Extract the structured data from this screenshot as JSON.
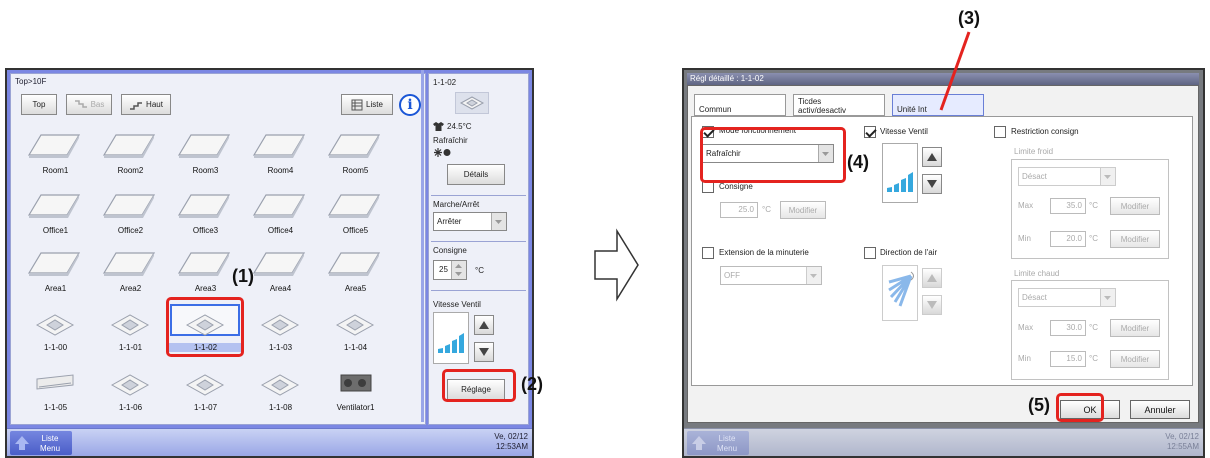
{
  "left": {
    "breadcrumb": "Top>10F",
    "toolbar": {
      "top": "Top",
      "bas": "Bas",
      "haut": "Haut",
      "liste": "Liste",
      "info": "i"
    },
    "rows": [
      {
        "type": "ceiling",
        "labels": [
          "Room1",
          "Room2",
          "Room3",
          "Room4",
          "Room5"
        ]
      },
      {
        "type": "ceiling",
        "labels": [
          "Office1",
          "Office2",
          "Office3",
          "Office4",
          "Office5"
        ]
      },
      {
        "type": "ceiling",
        "labels": [
          "Area1",
          "Area2",
          "Area3",
          "Area4",
          "Area5"
        ]
      },
      {
        "type": "cassette",
        "labels": [
          "1-1-00",
          "1-1-01",
          "1-1-02",
          "1-1-03",
          "1-1-04"
        ]
      },
      {
        "type": "mixed",
        "labels": [
          "1-1-05",
          "1-1-06",
          "1-1-07",
          "1-1-08",
          "Ventilator1"
        ]
      }
    ],
    "selected_unit": "1-1-02",
    "panel": {
      "unit": "1-1-02",
      "temperature": "24.5°C",
      "mode": "Rafraîchir",
      "details_btn": "Détails",
      "onoff_label": "Marche/Arrêt",
      "onoff_value": "Arrêter",
      "setpoint_label": "Consigne",
      "setpoint_value": "25",
      "setpoint_unit": "°C",
      "fan_label": "Vitesse Ventil",
      "reglage_btn": "Réglage"
    },
    "taskbar": {
      "liste": "Liste",
      "menu": "Menu",
      "date": "Ve, 02/12",
      "time": "12:53AM"
    }
  },
  "callouts": {
    "c1": "(1)",
    "c2": "(2)",
    "c3": "(3)",
    "c4": "(4)",
    "c5": "(5)"
  },
  "right": {
    "title": "Régl détaillé : 1-1-02",
    "tabs": {
      "commun": "Commun",
      "ticdes1": "Ticdes",
      "ticdes2": "activ/desactiv",
      "unite": "Unité Int"
    },
    "mode": {
      "label": "Mode fonctionnement",
      "value": "Rafraîchir"
    },
    "consigne": {
      "label": "Consigne",
      "value": "25.0",
      "unit": "°C",
      "modify": "Modifier"
    },
    "minuterie": {
      "label": "Extension de la minuterie",
      "value": "OFF"
    },
    "vitesse": {
      "label": "Vitesse Ventil"
    },
    "direction": {
      "label": "Direction de l'air"
    },
    "restriction": {
      "label": "Restriction consign",
      "froid": {
        "label": "Limite froid",
        "value": "Désact",
        "max_label": "Max",
        "max": "35.0",
        "min_label": "Min",
        "min": "20.0"
      },
      "chaud": {
        "label": "Limite chaud",
        "value": "Désact",
        "max_label": "Max",
        "max": "30.0",
        "min_label": "Min",
        "min": "15.0"
      },
      "unit": "°C",
      "modify": "Modifier"
    },
    "ok": "OK",
    "cancel": "Annuler",
    "taskbar": {
      "liste": "Liste",
      "menu": "Menu",
      "date": "Ve, 02/12",
      "time": "12:55AM"
    }
  }
}
